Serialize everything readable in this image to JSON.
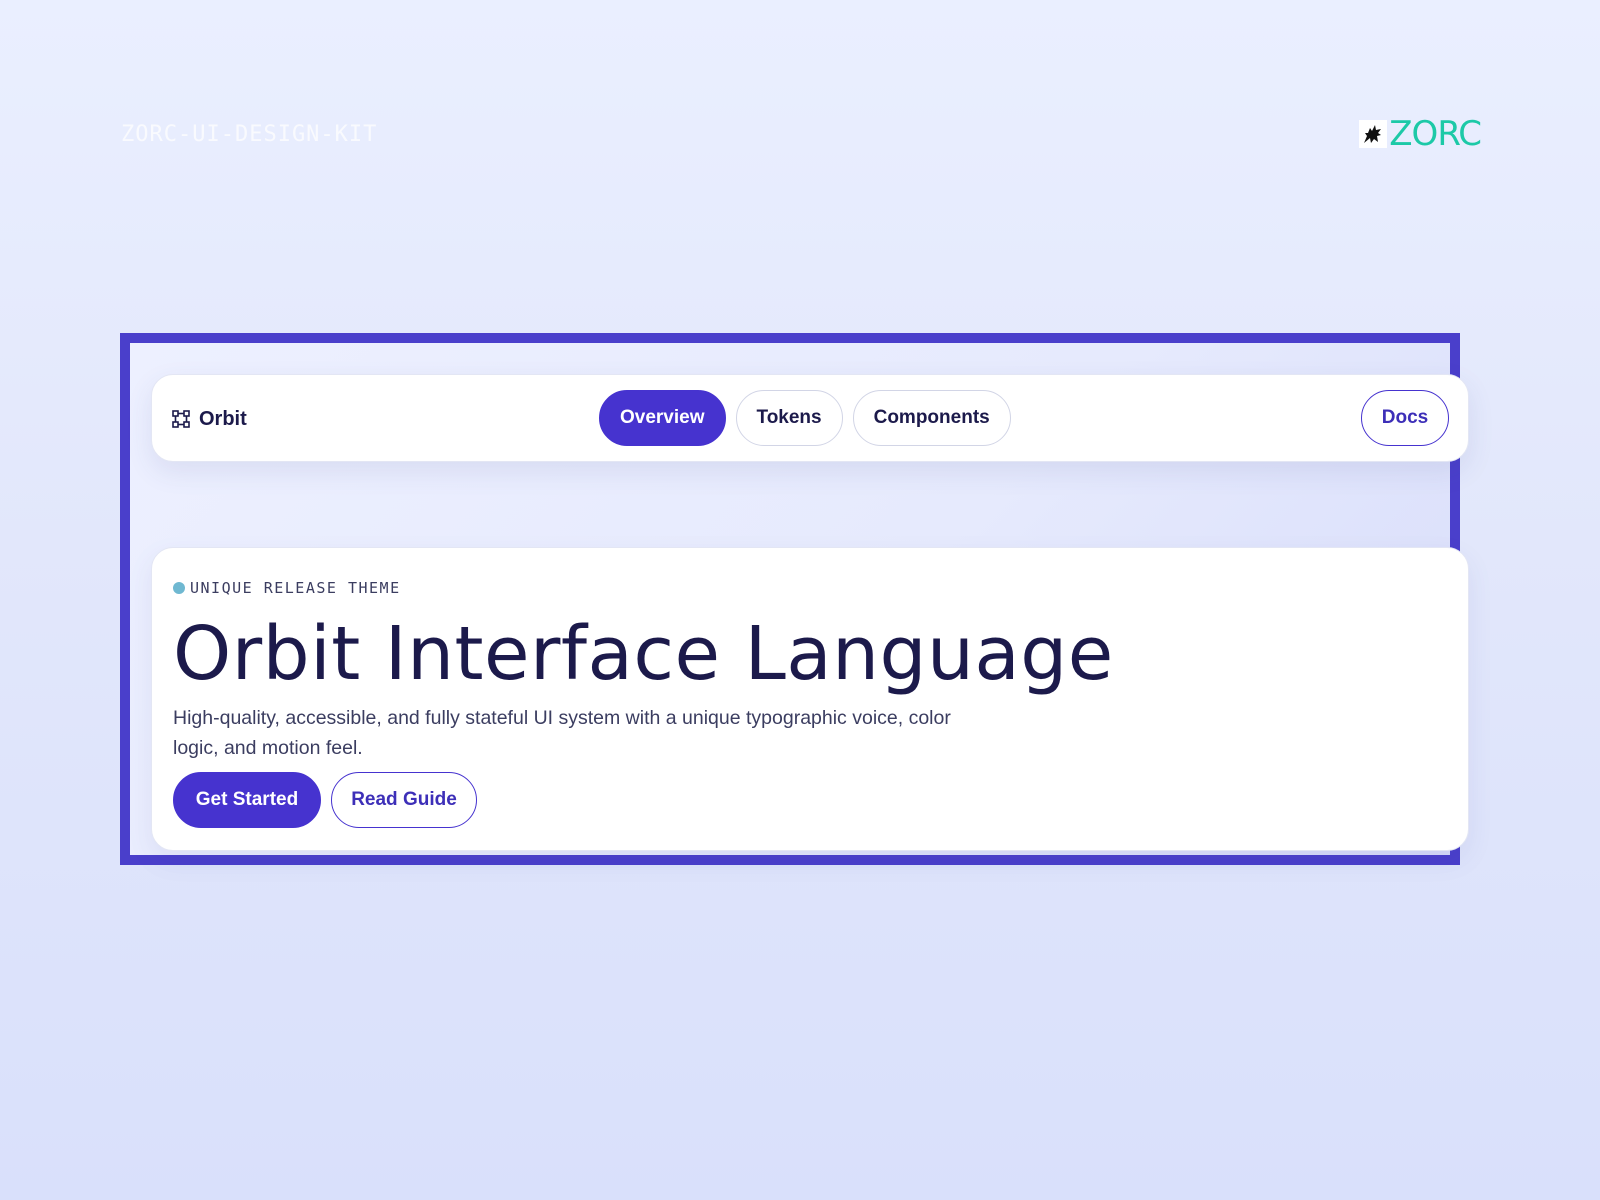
{
  "kit_label": "ZORC-UI-DESIGN-KIT",
  "brand": {
    "wordmark": "ZORC",
    "mark_icon": "wolf-icon",
    "color": "#1cc9a7"
  },
  "navbar": {
    "brand_label": "Orbit",
    "brand_icon": "vector-square-icon",
    "tabs": [
      {
        "label": "Overview",
        "active": true
      },
      {
        "label": "Tokens",
        "active": false
      },
      {
        "label": "Components",
        "active": false
      }
    ],
    "docs_label": "Docs"
  },
  "hero": {
    "eyebrow": "UNIQUE RELEASE THEME",
    "title": "Orbit Interface Language",
    "subtitle": "High-quality, accessible, and fully stateful UI system with a unique typographic voice, color logic, and motion feel.",
    "primary_action": "Get Started",
    "secondary_action": "Read Guide"
  },
  "colors": {
    "accent": "#4633cf",
    "frame": "#4a3fcb",
    "text": "#1c1a4b",
    "eyebrow_dot": "#6fb8d1"
  }
}
